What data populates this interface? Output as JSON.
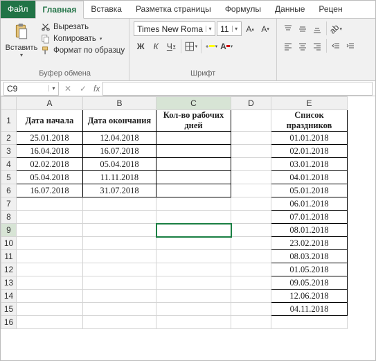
{
  "menu": {
    "file": "Файл",
    "home": "Главная",
    "insert": "Вставка",
    "pagelayout": "Разметка страницы",
    "formulas": "Формулы",
    "data": "Данные",
    "review": "Рецен"
  },
  "ribbon": {
    "clipboard": {
      "paste": "Вставить",
      "cut": "Вырезать",
      "copy": "Копировать",
      "format_painter": "Формат по образцу",
      "group": "Буфер обмена"
    },
    "font": {
      "name": "Times New Roma",
      "size": "11",
      "group": "Шрифт",
      "bold": "Ж",
      "italic": "К",
      "underline": "Ч"
    },
    "align": {
      "group": ""
    }
  },
  "namebox": "C9",
  "formula_bar": "",
  "fx_label": "fx",
  "columns": [
    "A",
    "B",
    "C",
    "D",
    "E"
  ],
  "rows": [
    "1",
    "2",
    "3",
    "4",
    "5",
    "6",
    "7",
    "8",
    "9",
    "10",
    "11",
    "12",
    "13",
    "14",
    "15",
    "16"
  ],
  "headers": {
    "A": "Дата начала",
    "B": "Дата окончания",
    "C": "Кол-во рабочих дней",
    "E": "Список праздников"
  },
  "dates": {
    "start": [
      "25.01.2018",
      "16.04.2018",
      "02.02.2018",
      "05.04.2018",
      "16.07.2018"
    ],
    "end": [
      "12.04.2018",
      "16.07.2018",
      "05.04.2018",
      "11.11.2018",
      "31.07.2018"
    ]
  },
  "holidays": [
    "01.01.2018",
    "02.01.2018",
    "03.01.2018",
    "04.01.2018",
    "05.01.2018",
    "06.01.2018",
    "07.01.2018",
    "08.01.2018",
    "23.02.2018",
    "08.03.2018",
    "01.05.2018",
    "09.05.2018",
    "12.06.2018",
    "04.11.2018"
  ],
  "selected_cell": "C9"
}
